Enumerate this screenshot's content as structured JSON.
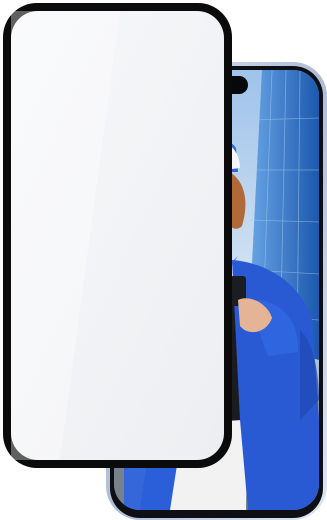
{
  "product": {
    "name": "tempered-glass-screen-protector",
    "colors": {
      "background": "#ffffff",
      "glass_border": "#0b0b0b",
      "phone_frame": "#c9d3e6",
      "jacket_blue": "#2b5fd9",
      "cap_blue": "#2f66dc",
      "sky": "#bcd4ee",
      "building_glass": "#3b7fd0"
    }
  },
  "scene": {
    "subject": "person-in-blue-jacket-and-cap",
    "icon_names": [
      "screen-protector-icon",
      "smartphone-icon",
      "dynamic-island-icon"
    ]
  }
}
